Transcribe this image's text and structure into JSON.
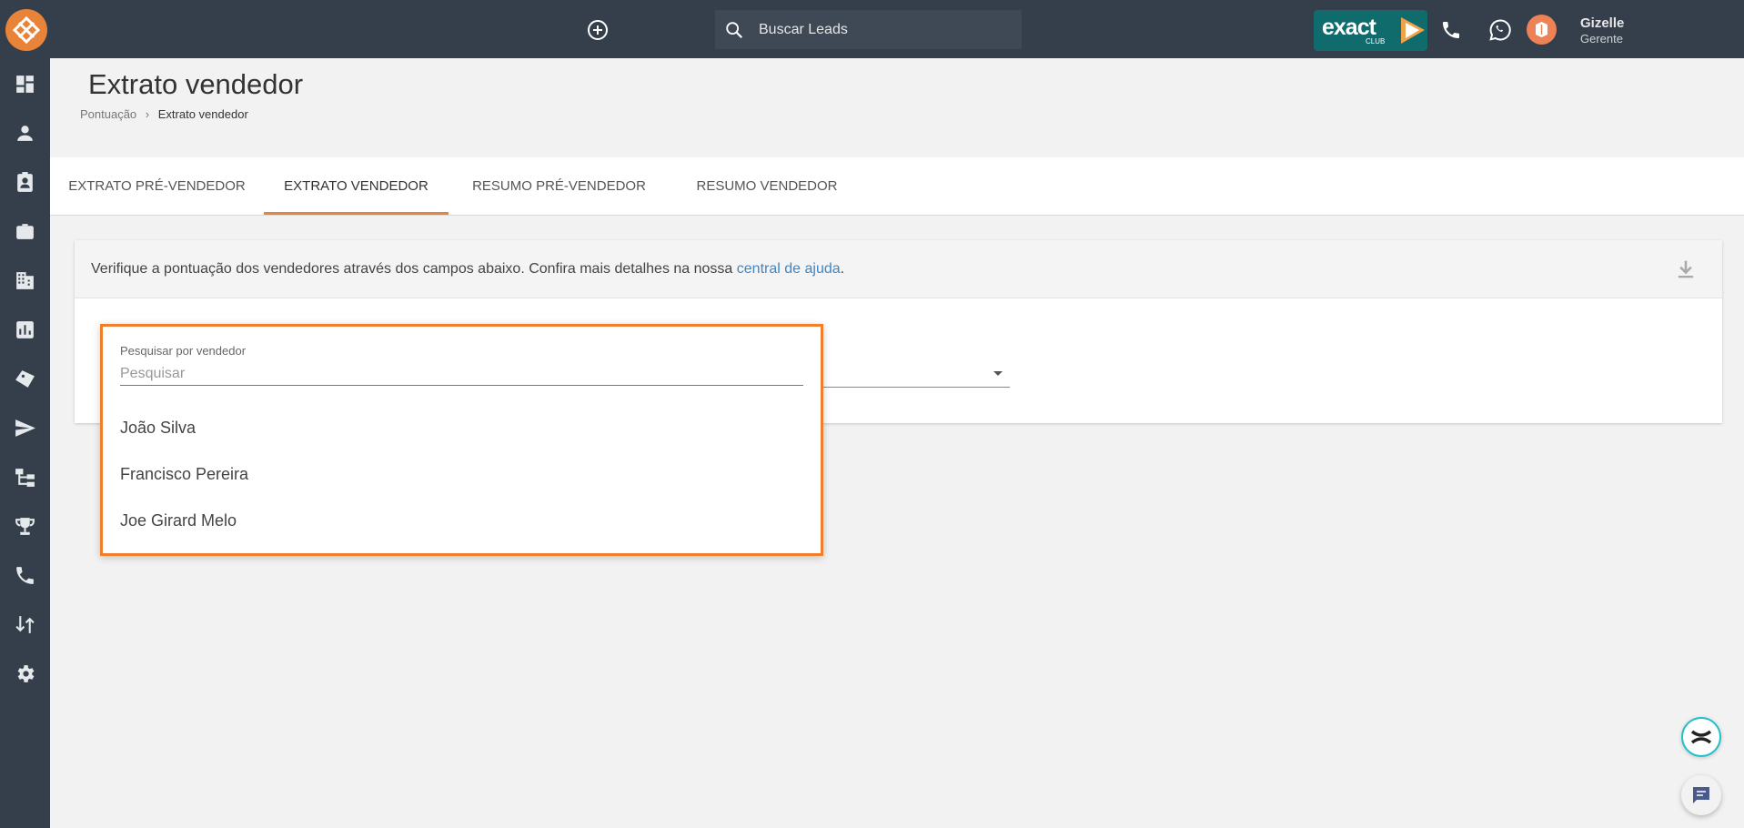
{
  "topbar": {
    "search_placeholder": "Buscar Leads",
    "exact_badge_text": "exact",
    "exact_badge_sub": "CLUB",
    "user_name": "Gizelle",
    "user_role": "Gerente"
  },
  "sidebar": {
    "items": [
      {
        "icon": "dashboard-icon"
      },
      {
        "icon": "person-icon"
      },
      {
        "icon": "contact-card-icon"
      },
      {
        "icon": "briefcase-icon"
      },
      {
        "icon": "building-icon"
      },
      {
        "icon": "reports-icon"
      },
      {
        "icon": "tag-icon"
      },
      {
        "icon": "send-icon"
      },
      {
        "icon": "hierarchy-icon"
      },
      {
        "icon": "trophy-icon"
      },
      {
        "icon": "phone-icon"
      },
      {
        "icon": "transfer-icon"
      },
      {
        "icon": "gear-icon"
      }
    ]
  },
  "page": {
    "title": "Extrato vendedor",
    "breadcrumb_parent": "Pontuação",
    "breadcrumb_current": "Extrato vendedor"
  },
  "tabs": [
    {
      "label": "EXTRATO PRÉ-VENDEDOR",
      "active": false
    },
    {
      "label": "EXTRATO VENDEDOR",
      "active": true
    },
    {
      "label": "RESUMO PRÉ-VENDEDOR",
      "active": false
    },
    {
      "label": "RESUMO VENDEDOR",
      "active": false
    }
  ],
  "info": {
    "text_before": "Verifique a pontuação dos vendedores através dos campos abaixo. Confira mais detalhes na nossa ",
    "link_text": "central de ajuda",
    "text_after": "."
  },
  "dropdown": {
    "label": "Pesquisar por vendedor",
    "placeholder": "Pesquisar",
    "value": "",
    "options": [
      "João Silva",
      "Francisco Pereira",
      "Joe Girard Melo"
    ]
  },
  "colors": {
    "topbar": "#343f4b",
    "accent": "#e8833a",
    "highlight_border": "#f07e2c",
    "link": "#3e86c4",
    "exact_badge": "#0f6b6c"
  }
}
